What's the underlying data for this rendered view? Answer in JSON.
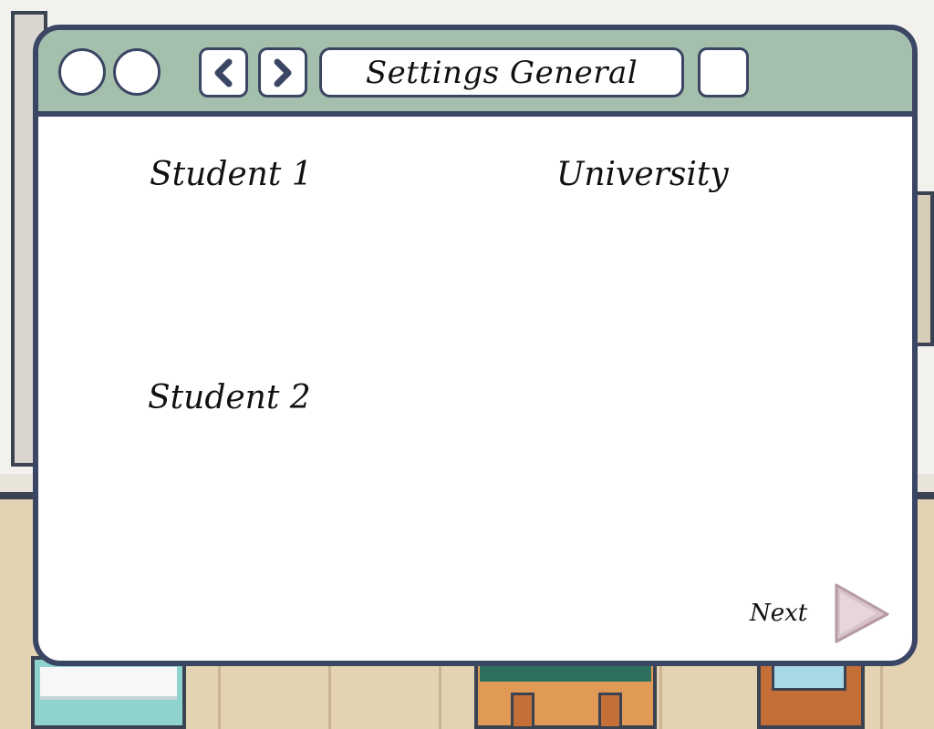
{
  "window": {
    "title": "Settings General"
  },
  "content": {
    "student1_label": "Student 1",
    "university_label": "University",
    "student2_label": "Student 2",
    "next_label": "Next"
  },
  "icons": {
    "back": "chevron-left-icon",
    "forward": "chevron-right-icon",
    "next": "play-triangle-icon"
  },
  "colors": {
    "titlebar": "#a5bfad",
    "frame": "#3b4664",
    "content_bg": "#ffffff",
    "next_arrow": "#d7c3c8"
  }
}
